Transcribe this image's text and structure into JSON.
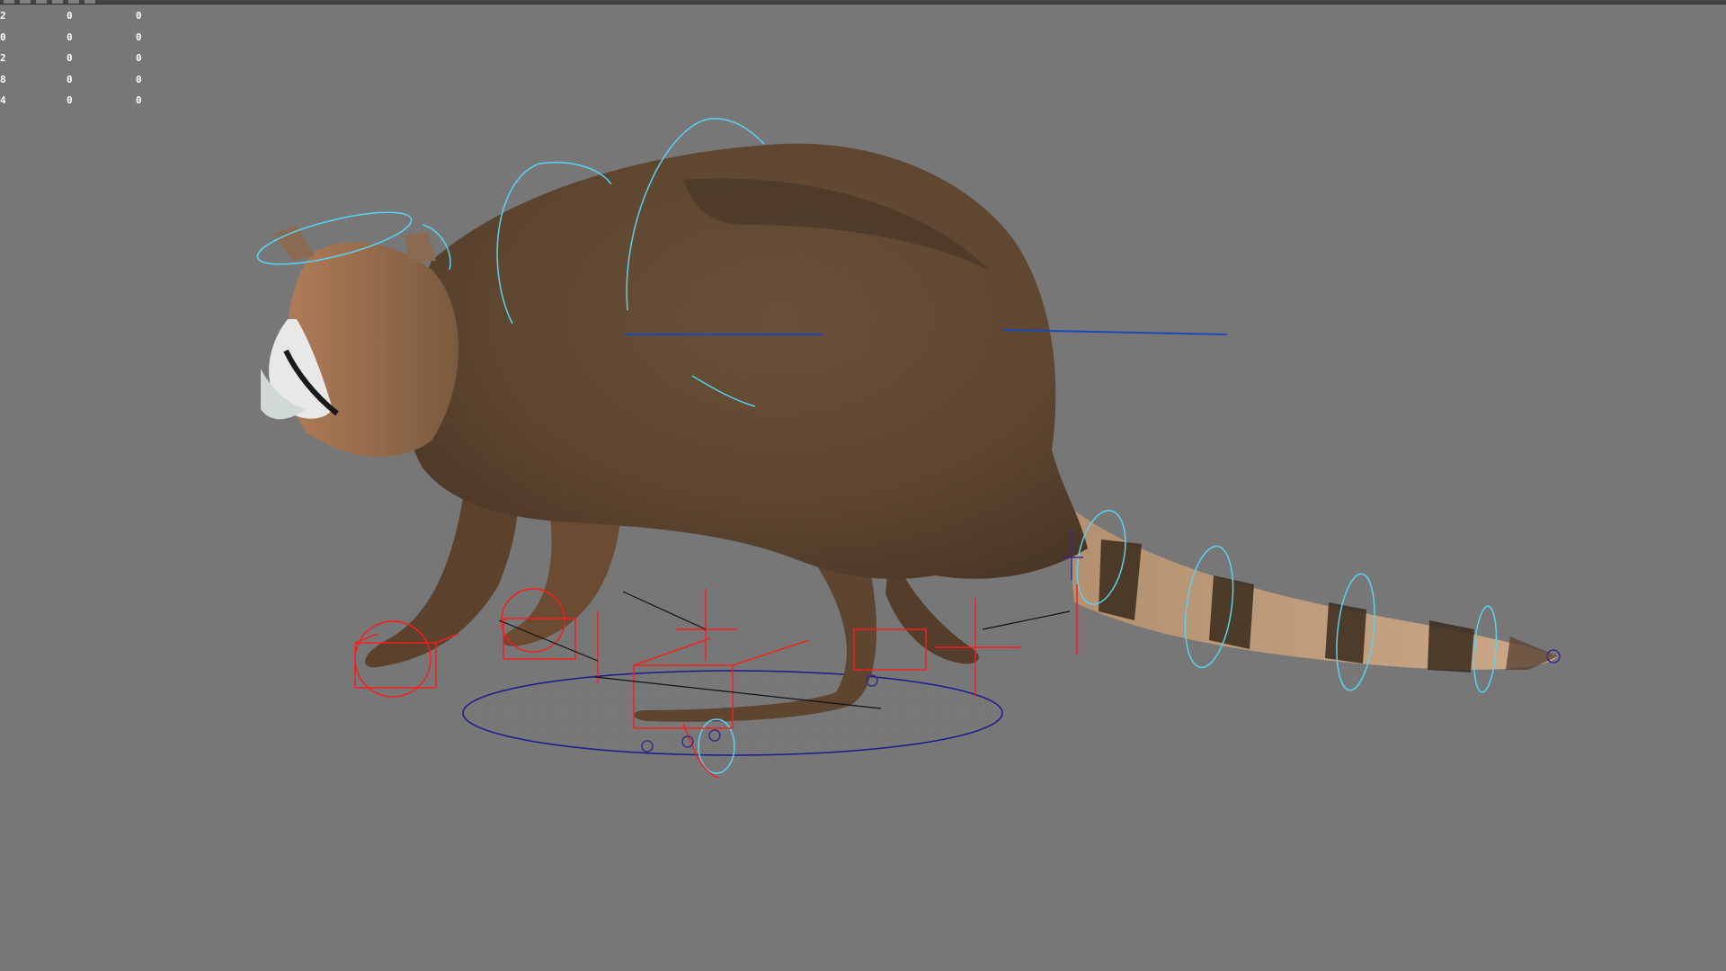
{
  "toolbar": {
    "icons": [
      "select-tool-icon",
      "move-tool-icon",
      "rotate-tool-icon",
      "scale-tool-icon",
      "snap-icon",
      "render-icon"
    ]
  },
  "hud": {
    "rows": [
      [
        "2",
        "0",
        "0"
      ],
      [
        "0",
        "0",
        "0"
      ],
      [
        "2",
        "0",
        "0"
      ],
      [
        "8",
        "0",
        "0"
      ],
      [
        "4",
        "0",
        "0"
      ]
    ]
  },
  "colors": {
    "background": "#777777",
    "ik_control": "#ff1a1a",
    "fk_control": "#5ad2f0",
    "root_control": "#1a1a8c",
    "fur": "#6e5236"
  }
}
